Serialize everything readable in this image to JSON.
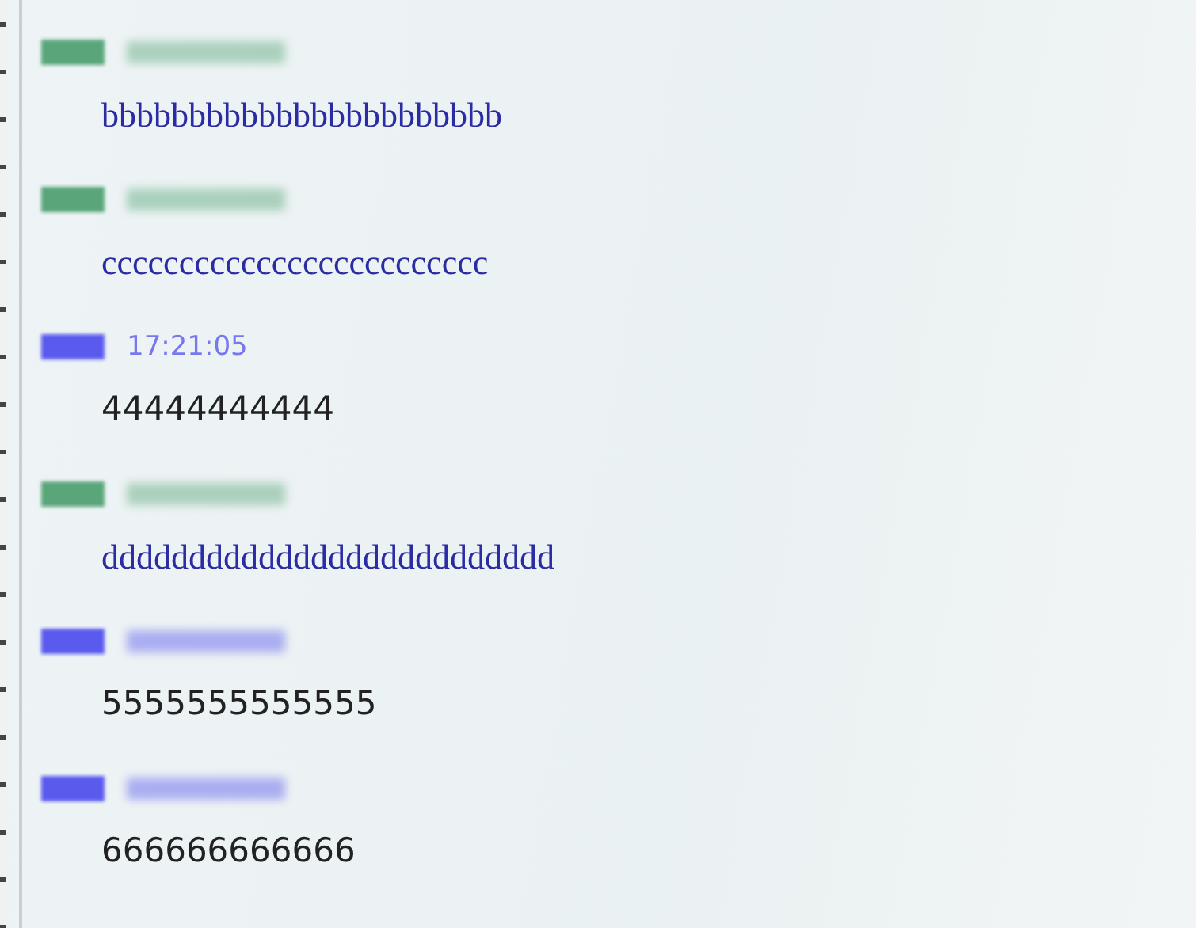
{
  "messages": [
    {
      "kind": "received",
      "color": "#5aa67a",
      "text": "bbbbbbbbbbbbbbbbbbbbbbb"
    },
    {
      "kind": "received",
      "color": "#5aa67a",
      "text": "ccccccccccccccccccccccccc"
    },
    {
      "kind": "sent",
      "color": "#5a5aee",
      "time": "17:21:05",
      "text": "44444444444"
    },
    {
      "kind": "received",
      "color": "#5aa67a",
      "text": "dddddddddddddddddddddddddd"
    },
    {
      "kind": "sent",
      "color": "#5a5aee",
      "text": "5555555555555"
    },
    {
      "kind": "sent",
      "color": "#5a5aee",
      "text": "666666666666"
    }
  ]
}
